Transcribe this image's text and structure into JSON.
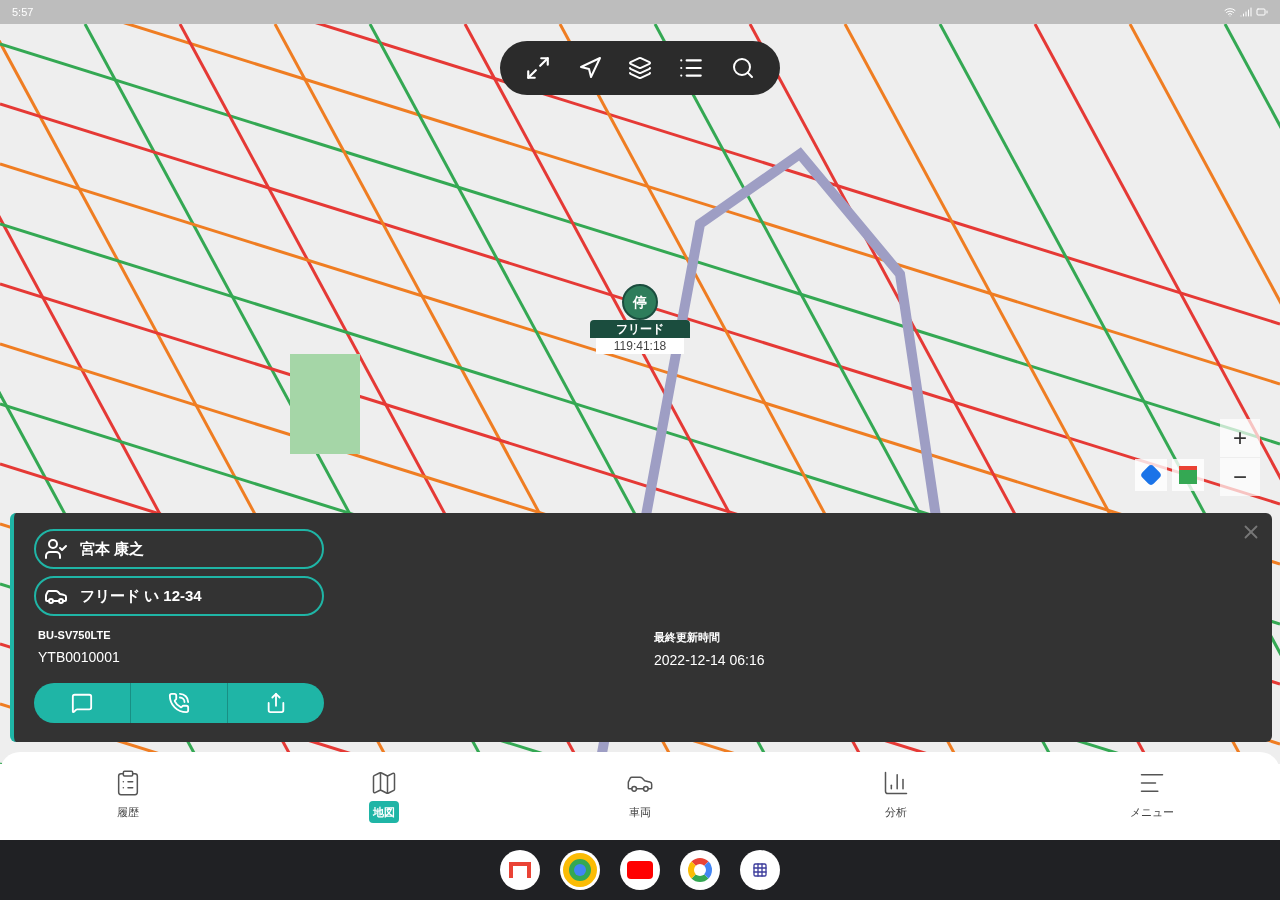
{
  "status_bar": {
    "time": "5:57"
  },
  "map": {
    "marker": {
      "badge": "停",
      "name": "フリード",
      "time": "119:41:18"
    },
    "zoom_in": "+",
    "zoom_out": "−"
  },
  "info_panel": {
    "driver": "宮本 康之",
    "vehicle": "フリード い 12-34",
    "device_label": "BU-SV750LTE",
    "device_id": "YTB0010001",
    "updated_label": "最終更新時間",
    "updated_value": "2022-12-14 06:16"
  },
  "bottom_nav": [
    {
      "label": "履歴",
      "selected": false
    },
    {
      "label": "地図",
      "selected": true
    },
    {
      "label": "車両",
      "selected": false
    },
    {
      "label": "分析",
      "selected": false
    },
    {
      "label": "メニュー",
      "selected": false
    }
  ]
}
